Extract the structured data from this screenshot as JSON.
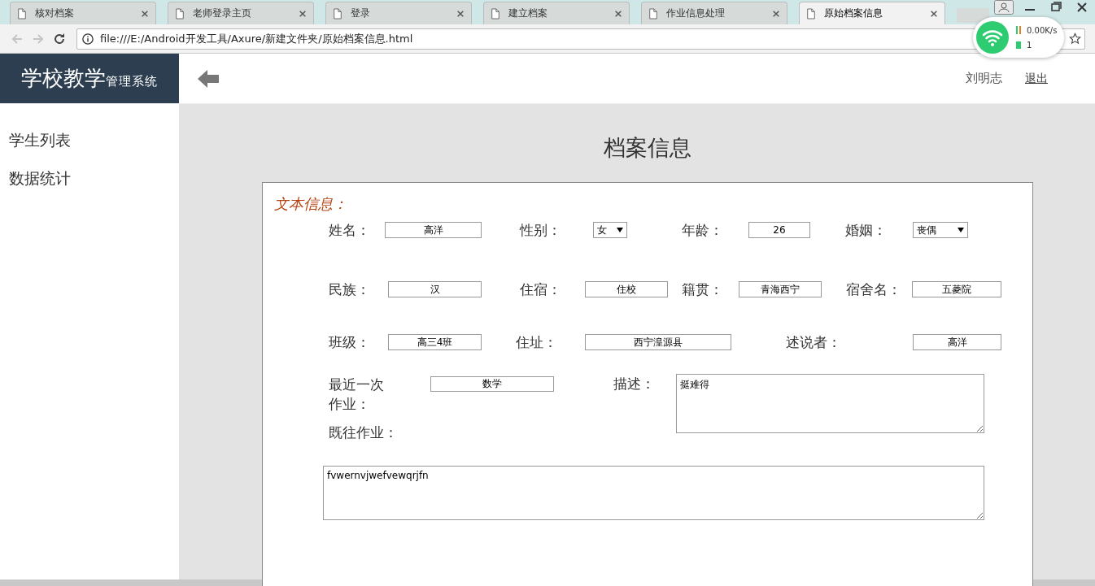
{
  "browser": {
    "tabs": [
      {
        "title": "核对档案",
        "selected": false
      },
      {
        "title": "老师登录主页",
        "selected": false
      },
      {
        "title": "登录",
        "selected": false
      },
      {
        "title": "建立档案",
        "selected": false
      },
      {
        "title": "作业信息处理",
        "selected": false
      },
      {
        "title": "原始档案信息",
        "selected": true
      }
    ],
    "address": "file:///E:/Android开发工具/Axure/新建文件夹/原始档案信息.html",
    "network_widget": {
      "speed": "0.00K/s",
      "count": "1"
    }
  },
  "header": {
    "logo_title": "学校教学",
    "logo_subtitle": "管理系统",
    "user": "刘明志",
    "logout": "退出"
  },
  "sidebar": {
    "items": [
      {
        "label": "学生列表"
      },
      {
        "label": "数据统计"
      }
    ]
  },
  "page_title": "档案信息",
  "section_title": "文本信息：",
  "rows": [
    [
      {
        "label": "姓名：",
        "kind": "input",
        "value": "高洋"
      },
      {
        "label": "性别：",
        "kind": "select",
        "value": "女"
      },
      {
        "label": "年龄：",
        "kind": "input",
        "value": "26"
      },
      {
        "label": "婚姻：",
        "kind": "select",
        "value": "丧偶"
      }
    ],
    [
      {
        "label": "民族：",
        "kind": "input",
        "value": "汉"
      },
      {
        "label": "住宿：",
        "kind": "input",
        "value": "住校"
      },
      {
        "label": "籍贯：",
        "kind": "input",
        "value": "青海西宁"
      },
      {
        "label": "宿舍名：",
        "kind": "input",
        "value": "五菱院"
      }
    ],
    [
      {
        "label": "班级：",
        "kind": "input",
        "value": "高三4班"
      },
      {
        "label": "住址：",
        "kind": "input",
        "value": "西宁湟源县"
      },
      {
        "label": "述说者：",
        "kind": "input",
        "value": "高洋"
      }
    ],
    [
      {
        "label": "最近一次作业：",
        "kind": "input",
        "value": "数学"
      },
      {
        "label": "描述：",
        "kind": "textarea",
        "value": "挺难得"
      }
    ]
  ],
  "history": {
    "label": "既往作业：",
    "value": "fvwernvjwefvewqrjfn"
  }
}
